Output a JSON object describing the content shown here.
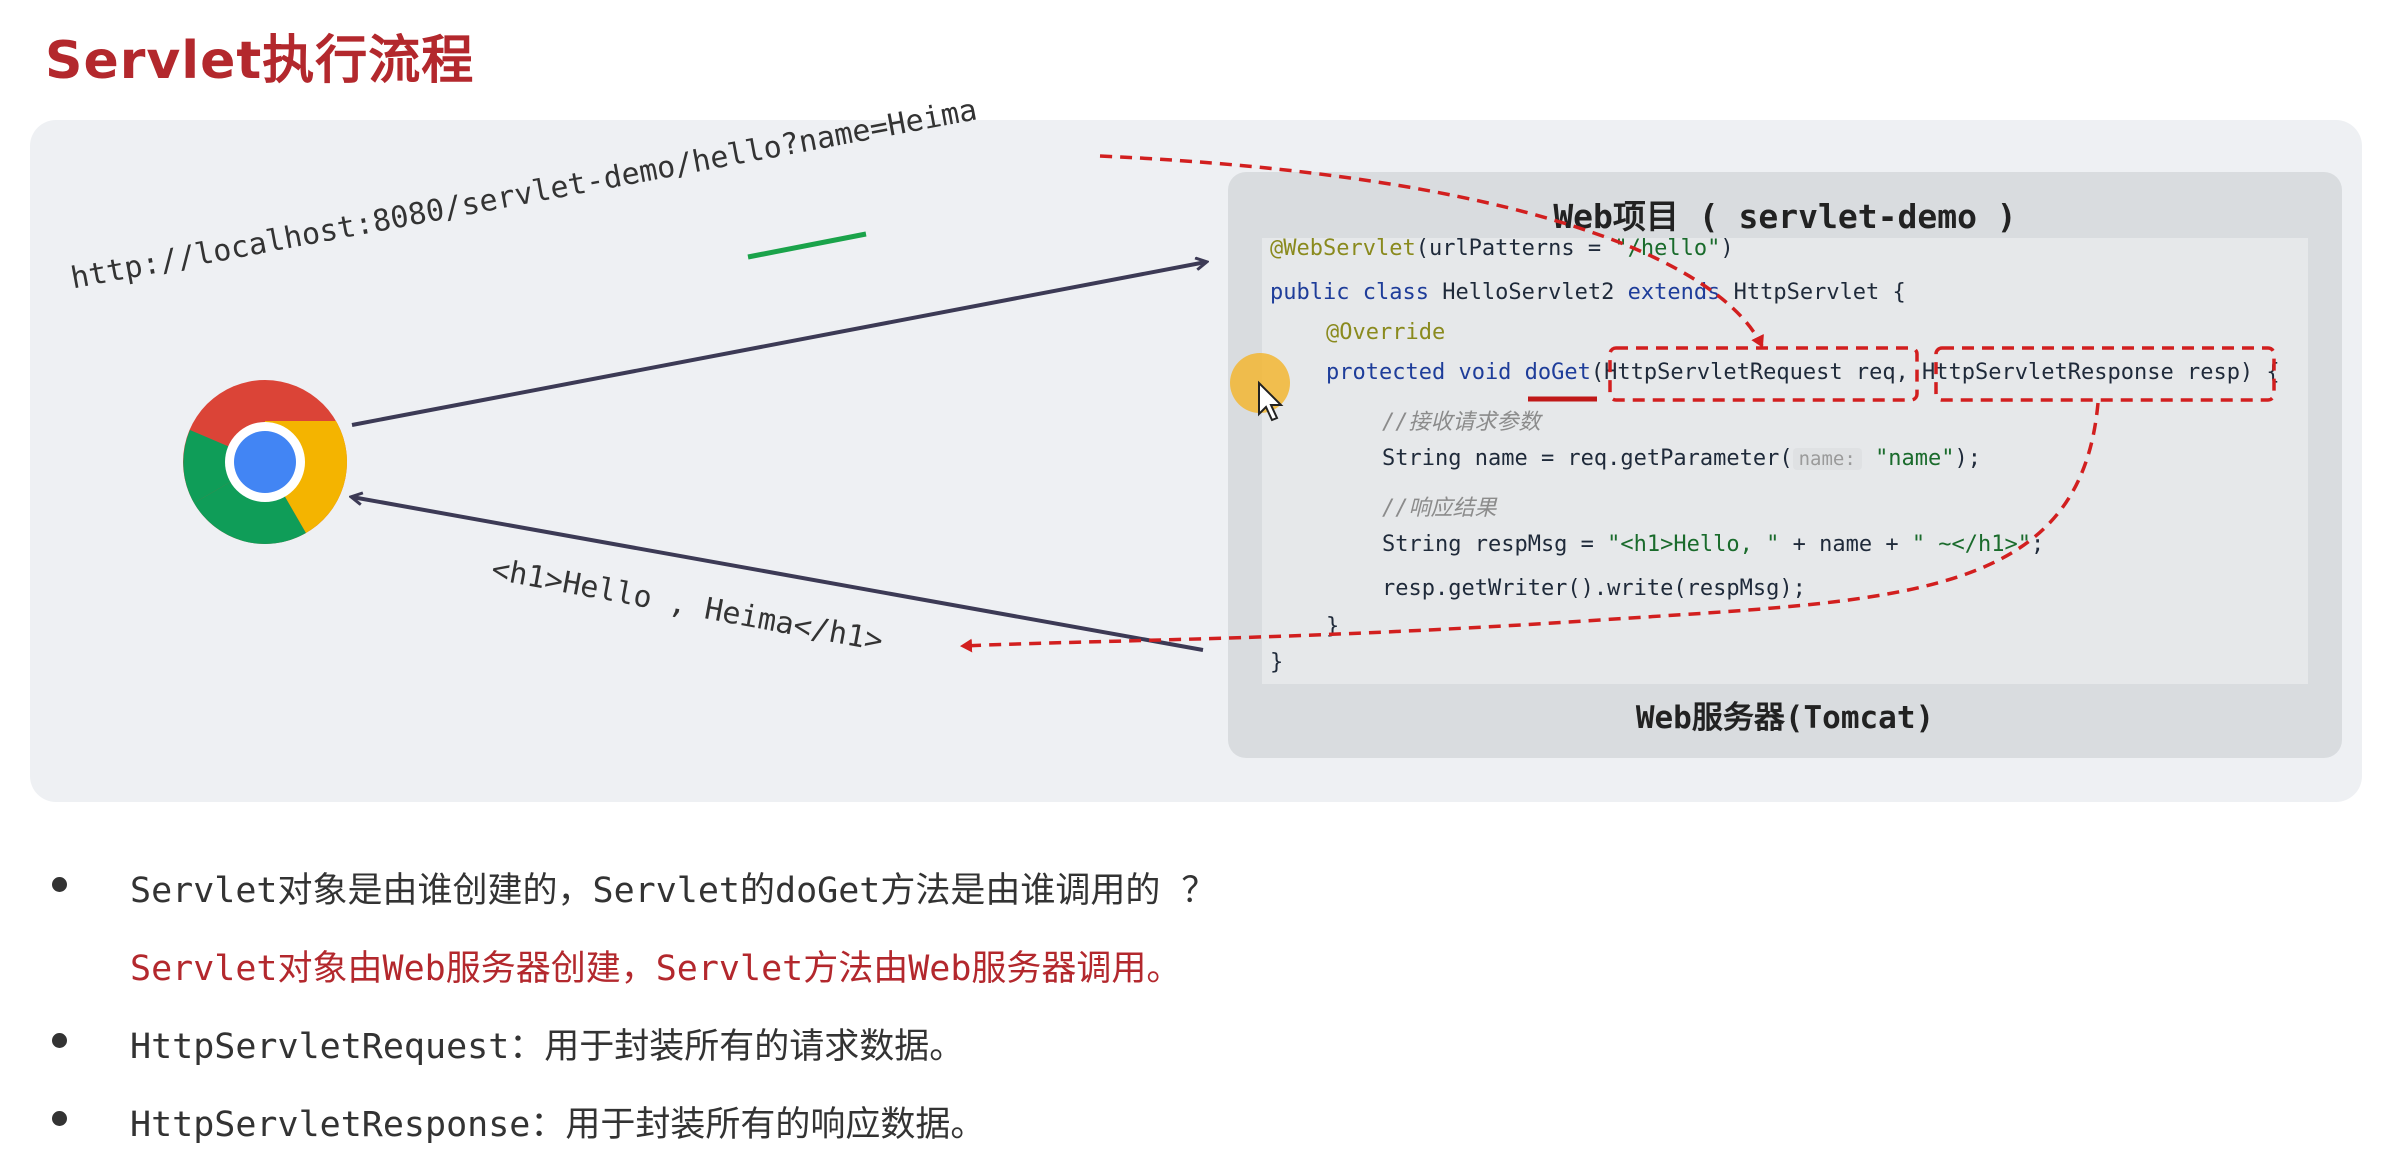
{
  "title": "Servlet执行流程",
  "diagram": {
    "request_url": "http://localhost:8080/servlet-demo/hello?name=Heima",
    "response_text": "<h1>Hello , Heima</h1>",
    "server_title": "Web项目 ( servlet-demo )",
    "server_footer": "Web服务器(Tomcat)",
    "code": {
      "line1_ann": "@WebServlet",
      "line1_rest": "(urlPatterns = ",
      "line1_str": "\"/hello\"",
      "line1_end": ")",
      "line2_kw": "public class",
      "line2_name": " HelloServlet2 ",
      "line2_kw2": "extends",
      "line2_end": " HttpServlet {",
      "line3": "@Override",
      "line4_kw": "protected void",
      "line4_method": " doGet",
      "line4_params": "(HttpServletRequest req, HttpServletResponse resp) {",
      "line5": "//接收请求参数",
      "line6_a": "String name = req.getParameter(",
      "line6_hint": "name:",
      "line6_str": "\"name\"",
      "line6_end": ");",
      "line7": "//响应结果",
      "line8_a": "String respMsg = ",
      "line8_str": "\"<h1>Hello, \"",
      "line8_b": " + name + ",
      "line8_str2": "\" ~</h1>\"",
      "line8_end": ";",
      "line9": "resp.getWriter().write(respMsg);",
      "line10": "}",
      "line11": "}"
    }
  },
  "bullets": [
    {
      "text": "Servlet对象是由谁创建的，Servlet的doGet方法是由谁调用的 ？"
    },
    {
      "text": "Servlet对象由Web服务器创建，Servlet方法由Web服务器调用。"
    },
    {
      "term": "HttpServletRequest",
      "desc": "：用于封装所有的请求数据。"
    },
    {
      "term": "HttpServletResponse",
      "desc": "：用于封装所有的响应数据。"
    }
  ],
  "colors": {
    "accent_red": "#b3282d",
    "arrow": "#3c3a55",
    "dashed": "#d21f1f",
    "underline_green": "#1aa34a"
  }
}
